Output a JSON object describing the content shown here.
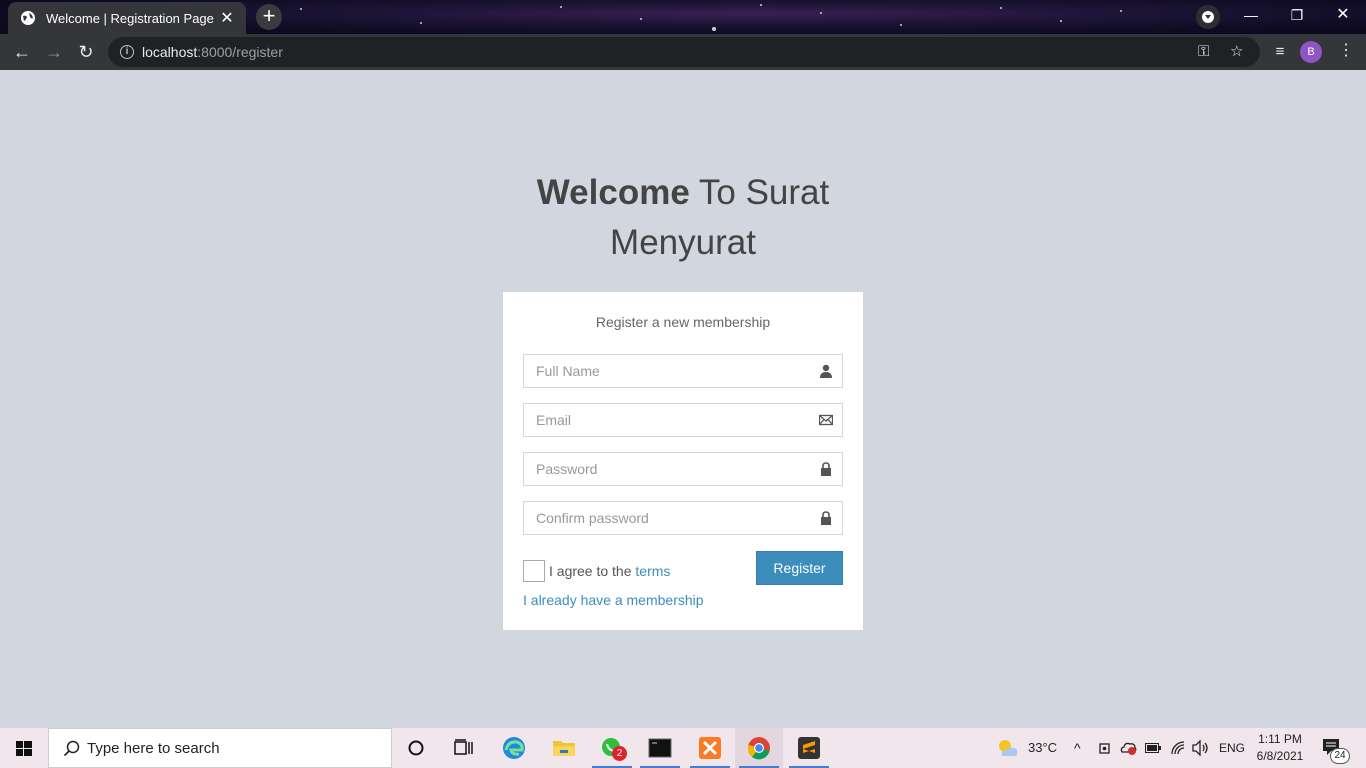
{
  "browser": {
    "tab_title": "Welcome | Registration Page",
    "url_host": "localhost",
    "url_rest": ":8000/register",
    "profile_initial": "B"
  },
  "page": {
    "heading_bold": "Welcome",
    "heading_rest": " To Surat Menyurat",
    "box_message": "Register a new membership",
    "fields": {
      "full_name_placeholder": "Full Name",
      "email_placeholder": "Email",
      "password_placeholder": "Password",
      "confirm_password_placeholder": "Confirm password"
    },
    "agree_prefix": "I agree to the ",
    "terms_link": "terms",
    "register_button": "Register",
    "membership_link": "I already have a membership"
  },
  "taskbar": {
    "search_placeholder": "Type here to search",
    "whatsapp_badge": "2",
    "temperature": "33°C",
    "language": "ENG",
    "time": "1:11 PM",
    "date": "6/8/2021",
    "notification_count": "24"
  },
  "colors": {
    "page_bg": "#d2d6de",
    "primary": "#3c8dbc",
    "chrome_dark": "#35363a"
  }
}
